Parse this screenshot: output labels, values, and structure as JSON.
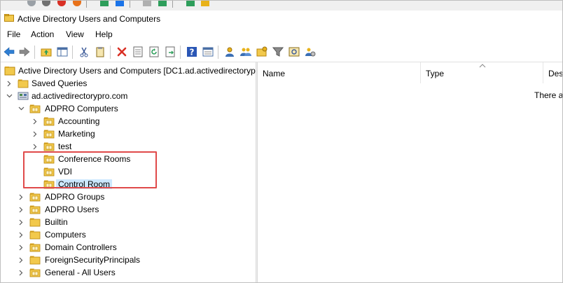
{
  "window": {
    "title": "Active Directory Users and Computers"
  },
  "menu": [
    "File",
    "Action",
    "View",
    "Help"
  ],
  "toolbar_icons": [
    "back-arrow-icon",
    "forward-arrow-icon",
    "up-folder-icon",
    "show-hide-tree-icon",
    "cut-icon",
    "copy-icon",
    "delete-icon",
    "properties-icon",
    "refresh-icon",
    "export-list-icon",
    "help-icon",
    "mmc-console-icon",
    "new-user-icon",
    "new-group-icon",
    "new-ou-icon",
    "filter-icon",
    "find-icon",
    "add-to-group-icon"
  ],
  "tree": {
    "root": "Active Directory Users and Computers [DC1.ad.activedirectorypr",
    "items": [
      {
        "label": "Saved Queries",
        "level": 1,
        "expander": "collapsed",
        "icon": "folder"
      },
      {
        "label": "ad.activedirectorypro.com",
        "level": 1,
        "expander": "expanded",
        "icon": "domain"
      },
      {
        "label": "ADPRO Computers",
        "level": 2,
        "expander": "expanded",
        "icon": "ou"
      },
      {
        "label": "Accounting",
        "level": 3,
        "expander": "collapsed",
        "icon": "ou"
      },
      {
        "label": "Marketing",
        "level": 3,
        "expander": "collapsed",
        "icon": "ou"
      },
      {
        "label": "test",
        "level": 3,
        "expander": "collapsed",
        "icon": "ou"
      },
      {
        "label": "Conference Rooms",
        "level": 3,
        "expander": "none",
        "icon": "ou"
      },
      {
        "label": "VDI",
        "level": 3,
        "expander": "none",
        "icon": "ou"
      },
      {
        "label": "Control Room",
        "level": 3,
        "expander": "none",
        "icon": "ou",
        "selected": true
      },
      {
        "label": "ADPRO Groups",
        "level": 2,
        "expander": "collapsed",
        "icon": "ou"
      },
      {
        "label": "ADPRO Users",
        "level": 2,
        "expander": "collapsed",
        "icon": "ou"
      },
      {
        "label": "Builtin",
        "level": 2,
        "expander": "collapsed",
        "icon": "folder"
      },
      {
        "label": "Computers",
        "level": 2,
        "expander": "collapsed",
        "icon": "folder"
      },
      {
        "label": "Domain Controllers",
        "level": 2,
        "expander": "collapsed",
        "icon": "ou"
      },
      {
        "label": "ForeignSecurityPrincipals",
        "level": 2,
        "expander": "collapsed",
        "icon": "folder"
      },
      {
        "label": "General - All Users",
        "level": 2,
        "expander": "collapsed",
        "icon": "ou"
      }
    ]
  },
  "list": {
    "columns": [
      "Name",
      "Type",
      "Desc"
    ],
    "empty_message": "There ar"
  },
  "colors": {
    "selection": "#cce8ff",
    "highlight_box": "#e04a4a",
    "folder": "#f2c94c",
    "folder_dark": "#d9a520"
  }
}
